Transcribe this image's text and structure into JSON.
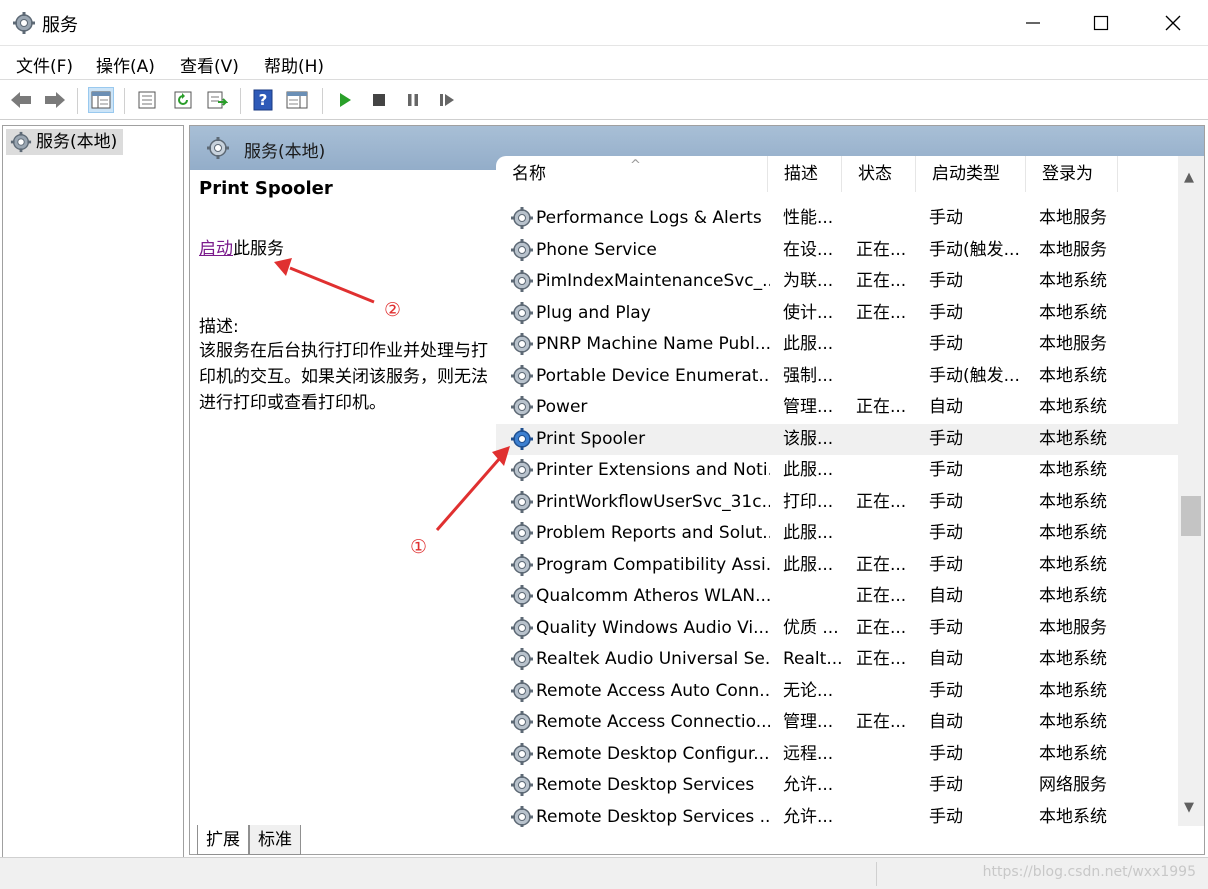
{
  "window": {
    "title": "服务"
  },
  "menu": {
    "items": [
      "文件(F)",
      "操作(A)",
      "查看(V)",
      "帮助(H)"
    ]
  },
  "tree": {
    "root_label": "服务(本地)"
  },
  "pane": {
    "header_label": "服务(本地)",
    "selected_service": "Print Spooler",
    "start_link": "启动",
    "start_suffix": "此服务",
    "desc_label": "描述:",
    "desc_text": "该服务在后台执行打印作业并处理与打印机的交互。如果关闭该服务，则无法进行打印或查看打印机。"
  },
  "columns": [
    "名称",
    "描述",
    "状态",
    "启动类型",
    "登录为"
  ],
  "services": [
    {
      "name": "Performance Logs & Alerts",
      "desc": "性能...",
      "status": "",
      "start": "手动",
      "logon": "本地服务"
    },
    {
      "name": "Phone Service",
      "desc": "在设...",
      "status": "正在...",
      "start": "手动(触发...",
      "logon": "本地服务"
    },
    {
      "name": "PimIndexMaintenanceSvc_...",
      "desc": "为联...",
      "status": "正在...",
      "start": "手动",
      "logon": "本地系统"
    },
    {
      "name": "Plug and Play",
      "desc": "使计...",
      "status": "正在...",
      "start": "手动",
      "logon": "本地系统"
    },
    {
      "name": "PNRP Machine Name Publ...",
      "desc": "此服...",
      "status": "",
      "start": "手动",
      "logon": "本地服务"
    },
    {
      "name": "Portable Device Enumerat...",
      "desc": "强制...",
      "status": "",
      "start": "手动(触发...",
      "logon": "本地系统"
    },
    {
      "name": "Power",
      "desc": "管理...",
      "status": "正在...",
      "start": "自动",
      "logon": "本地系统"
    },
    {
      "name": "Print Spooler",
      "desc": "该服...",
      "status": "",
      "start": "手动",
      "logon": "本地系统",
      "selected": true
    },
    {
      "name": "Printer Extensions and Noti...",
      "desc": "此服...",
      "status": "",
      "start": "手动",
      "logon": "本地系统"
    },
    {
      "name": "PrintWorkflowUserSvc_31c...",
      "desc": "打印...",
      "status": "正在...",
      "start": "手动",
      "logon": "本地系统"
    },
    {
      "name": "Problem Reports and Solut...",
      "desc": "此服...",
      "status": "",
      "start": "手动",
      "logon": "本地系统"
    },
    {
      "name": "Program Compatibility Assi...",
      "desc": "此服...",
      "status": "正在...",
      "start": "手动",
      "logon": "本地系统"
    },
    {
      "name": "Qualcomm Atheros WLAN...",
      "desc": "",
      "status": "正在...",
      "start": "自动",
      "logon": "本地系统"
    },
    {
      "name": "Quality Windows Audio Vi...",
      "desc": "优质 ...",
      "status": "正在...",
      "start": "手动",
      "logon": "本地服务"
    },
    {
      "name": "Realtek Audio Universal Se...",
      "desc": "Realt...",
      "status": "正在...",
      "start": "自动",
      "logon": "本地系统"
    },
    {
      "name": "Remote Access Auto Conn...",
      "desc": "无论...",
      "status": "",
      "start": "手动",
      "logon": "本地系统"
    },
    {
      "name": "Remote Access Connectio...",
      "desc": "管理...",
      "status": "正在...",
      "start": "自动",
      "logon": "本地系统"
    },
    {
      "name": "Remote Desktop Configur...",
      "desc": "远程...",
      "status": "",
      "start": "手动",
      "logon": "本地系统"
    },
    {
      "name": "Remote Desktop Services",
      "desc": "允许...",
      "status": "",
      "start": "手动",
      "logon": "网络服务"
    },
    {
      "name": "Remote Desktop Services ...",
      "desc": "允许...",
      "status": "",
      "start": "手动",
      "logon": "本地系统"
    }
  ],
  "tabs": [
    "扩展",
    "标准"
  ],
  "annotations": {
    "marker1": "①",
    "marker2": "②"
  },
  "watermark": "https://blog.csdn.net/wxx1995",
  "colors": {
    "accent_header": "#9fb7d0",
    "link": "#7a1a8c",
    "annotation": "#e03030"
  }
}
